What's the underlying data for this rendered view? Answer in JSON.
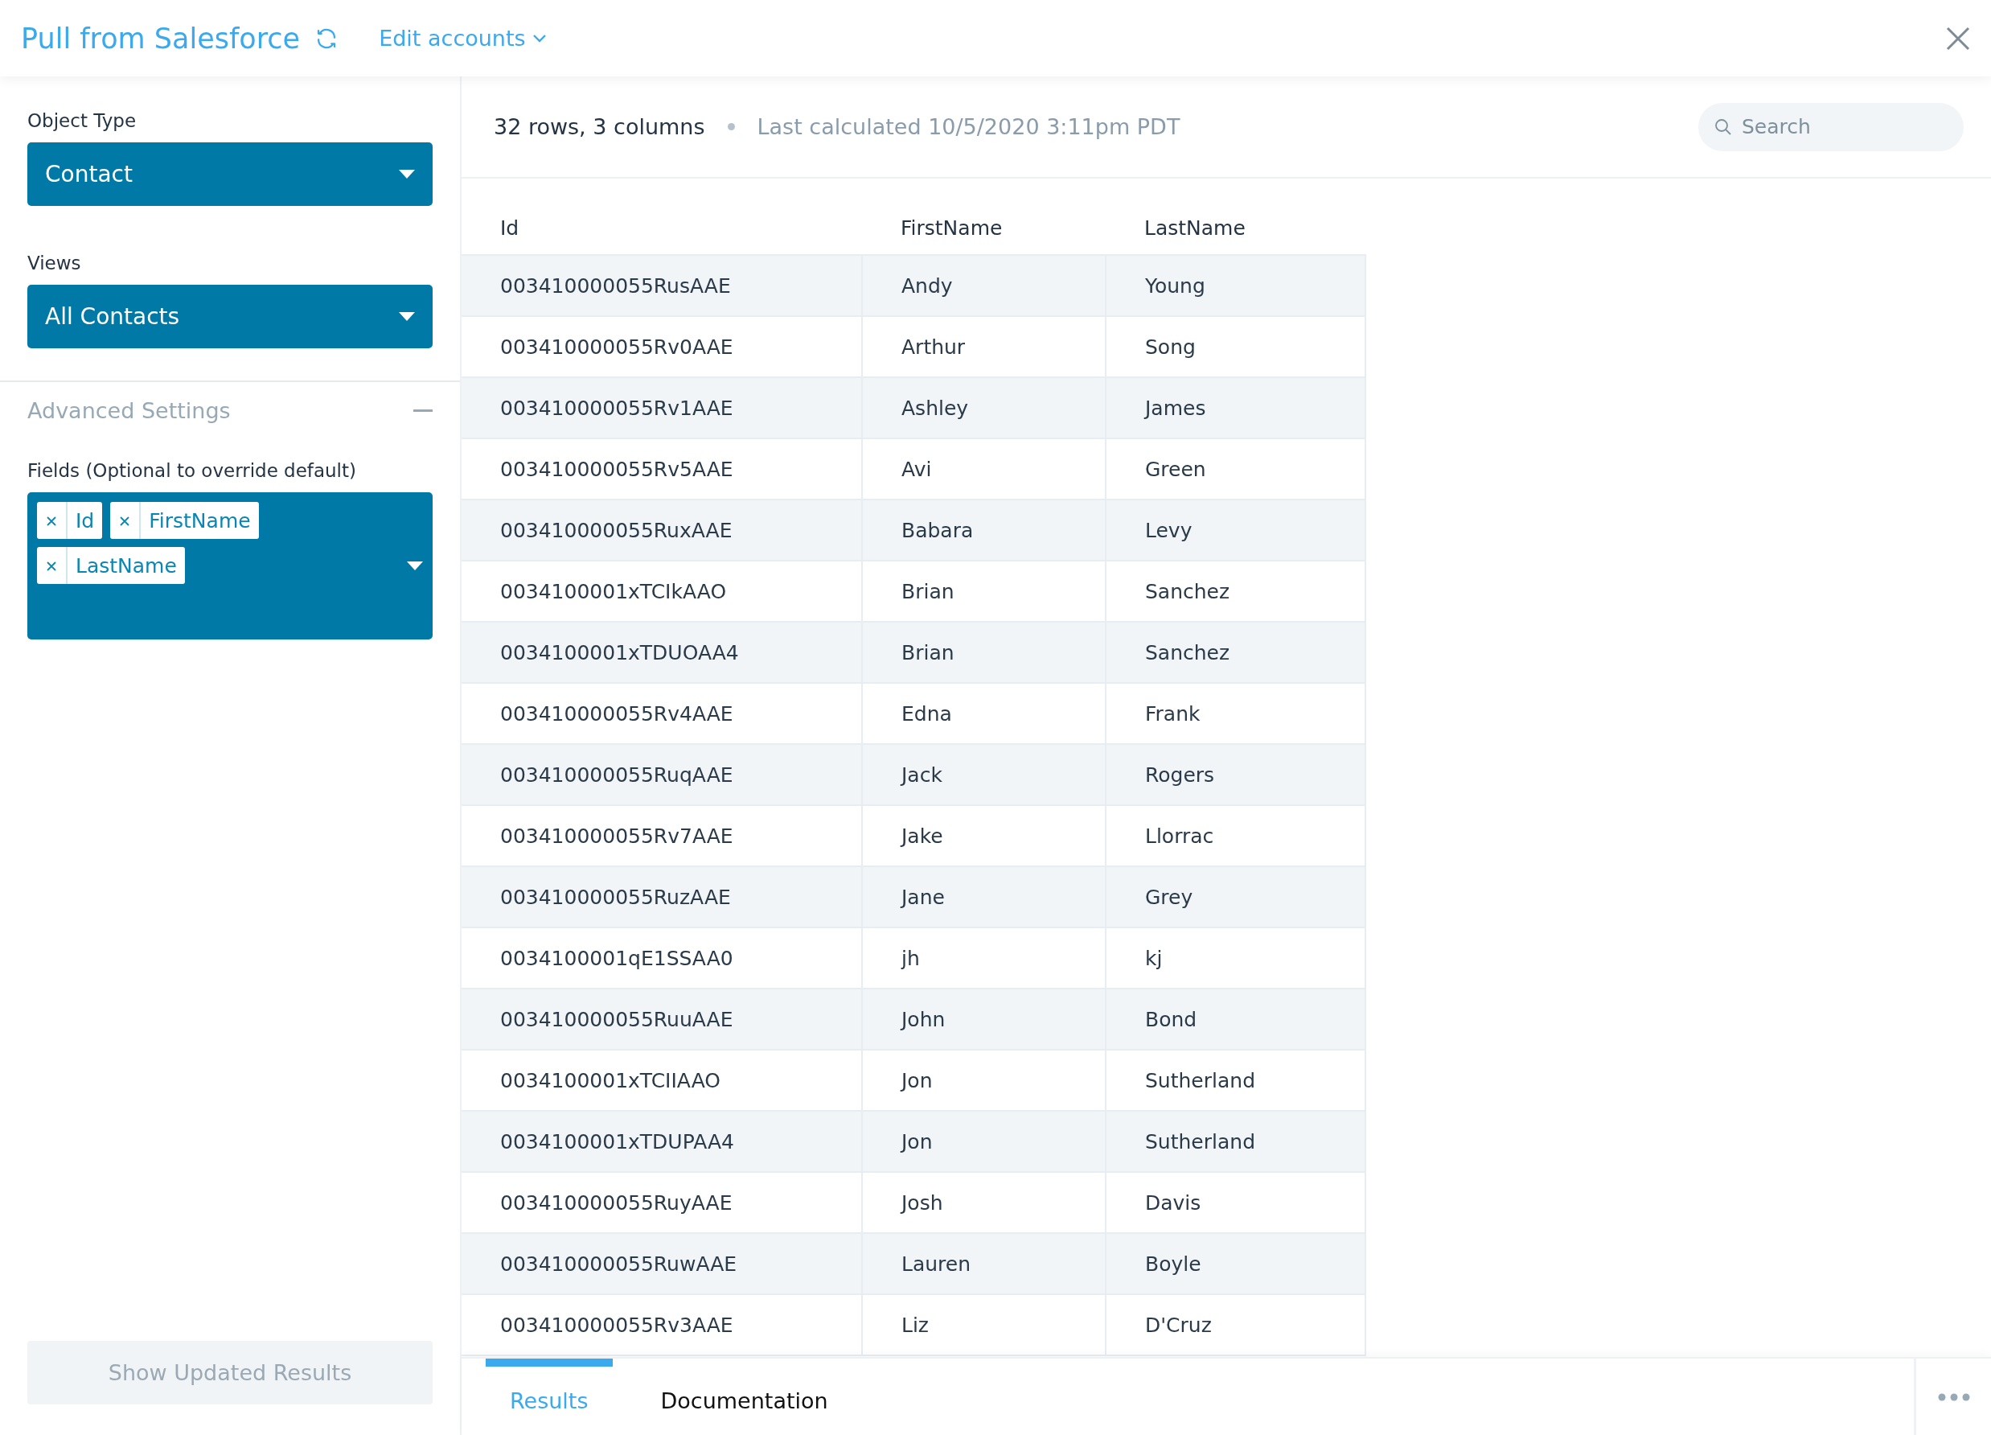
{
  "header": {
    "title": "Pull from Salesforce",
    "accounts_menu": "Edit accounts"
  },
  "sidebar": {
    "object_type": {
      "label": "Object Type",
      "value": "Contact"
    },
    "views": {
      "label": "Views",
      "value": "All Contacts"
    },
    "advanced_settings": {
      "label": "Advanced Settings",
      "expanded": true
    },
    "fields": {
      "label": "Fields (Optional to override default)",
      "tags": [
        "Id",
        "FirstName",
        "LastName"
      ]
    },
    "show_button": {
      "label": "Show Updated Results",
      "disabled": true
    }
  },
  "summary": {
    "size": "32 rows, 3 columns",
    "last_calculated": "Last calculated 10/5/2020 3:11pm PDT"
  },
  "search": {
    "placeholder": "Search"
  },
  "table": {
    "columns": [
      "Id",
      "FirstName",
      "LastName"
    ],
    "rows": [
      [
        "003410000055RusAAE",
        "Andy",
        "Young"
      ],
      [
        "003410000055Rv0AAE",
        "Arthur",
        "Song"
      ],
      [
        "003410000055Rv1AAE",
        "Ashley",
        "James"
      ],
      [
        "003410000055Rv5AAE",
        "Avi",
        "Green"
      ],
      [
        "003410000055RuxAAE",
        "Babara",
        "Levy"
      ],
      [
        "0034100001xTCIkAAO",
        "Brian",
        "Sanchez"
      ],
      [
        "0034100001xTDUOAA4",
        "Brian",
        "Sanchez"
      ],
      [
        "003410000055Rv4AAE",
        "Edna",
        "Frank"
      ],
      [
        "003410000055RuqAAE",
        "Jack",
        "Rogers"
      ],
      [
        "003410000055Rv7AAE",
        "Jake",
        "Llorrac"
      ],
      [
        "003410000055RuzAAE",
        "Jane",
        "Grey"
      ],
      [
        "0034100001qE1SSAA0",
        "jh",
        "kj"
      ],
      [
        "003410000055RuuAAE",
        "John",
        "Bond"
      ],
      [
        "0034100001xTCIIAAO",
        "Jon",
        "Sutherland"
      ],
      [
        "0034100001xTDUPAA4",
        "Jon",
        "Sutherland"
      ],
      [
        "003410000055RuyAAE",
        "Josh",
        "Davis"
      ],
      [
        "003410000055RuwAAE",
        "Lauren",
        "Boyle"
      ],
      [
        "003410000055Rv3AAE",
        "Liz",
        "D'Cruz"
      ]
    ]
  },
  "bottom_tabs": [
    {
      "label": "Results",
      "selected": true
    },
    {
      "label": "Documentation",
      "selected": false
    }
  ]
}
